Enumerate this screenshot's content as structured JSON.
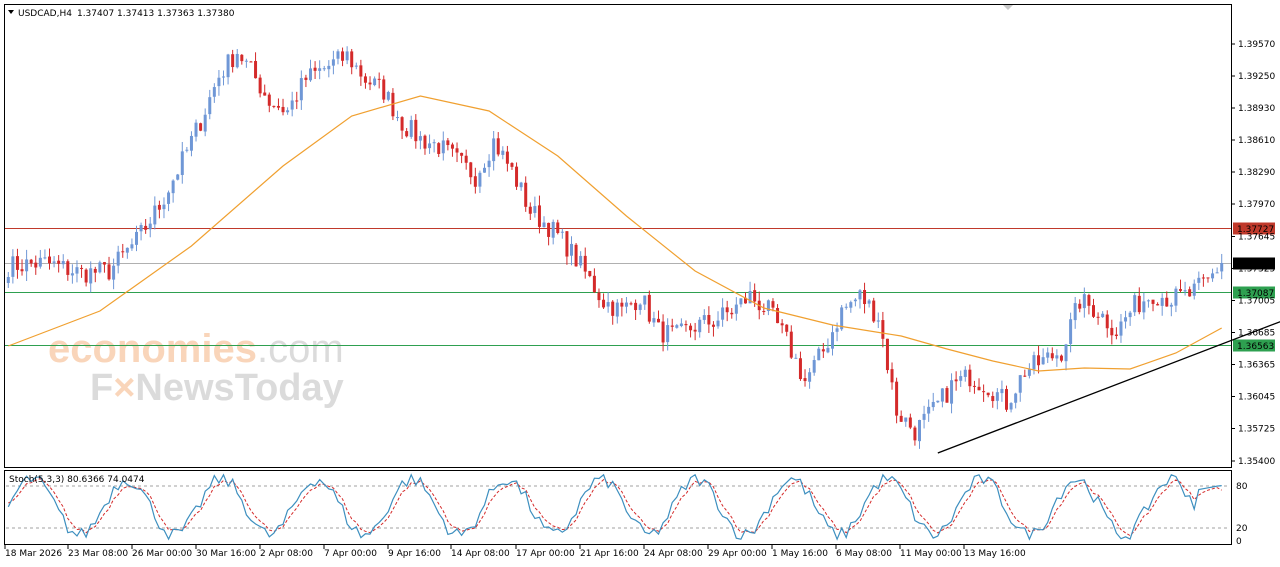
{
  "header": {
    "symbol": "USDCAD,H4",
    "ohlc": "1.37407 1.37413 1.37363 1.37380",
    "stoch_label": "Stoch(5,3,3) 80.6366 74.0474"
  },
  "watermark": {
    "brand_part1": "economies",
    "brand_part2": ".com",
    "line2_a": "F",
    "line2_b": "NewsToday"
  },
  "colors": {
    "bull": "#6f97d6",
    "bear": "#d42a2a",
    "ma": "#f0a030",
    "resistance": "#c0392b",
    "support": "#2ea050",
    "current": "#b0b0b0",
    "trendline": "#000000",
    "stoch_main": "#3d8fbf",
    "stoch_signal": "#d42a2a"
  },
  "chart_data": {
    "type": "candlestick",
    "symbol": "USDCAD",
    "timeframe": "H4",
    "ylim": [
      1.3535,
      1.3995
    ],
    "y_ticks": [
      "1.39570",
      "1.39250",
      "1.38930",
      "1.38610",
      "1.38290",
      "1.37970",
      "1.37645",
      "1.37325",
      "1.37005",
      "1.36685",
      "1.36365",
      "1.36045",
      "1.35725",
      "1.35400"
    ],
    "x_ticks": [
      "18 Mar 2026",
      "23 Mar 08:00",
      "26 Mar 00:00",
      "30 Mar 16:00",
      "2 Apr 08:00",
      "7 Apr 00:00",
      "9 Apr 16:00",
      "14 Apr 08:00",
      "17 Apr 00:00",
      "21 Apr 16:00",
      "24 Apr 08:00",
      "29 Apr 00:00",
      "1 May 16:00",
      "6 May 08:00",
      "11 May 00:00",
      "13 May 16:00"
    ],
    "price_path": [
      [
        0,
        1.3735
      ],
      [
        8,
        1.3738
      ],
      [
        16,
        1.3728
      ],
      [
        22,
        1.373
      ],
      [
        28,
        1.376
      ],
      [
        33,
        1.3795
      ],
      [
        38,
        1.384
      ],
      [
        42,
        1.388
      ],
      [
        46,
        1.3925
      ],
      [
        50,
        1.395
      ],
      [
        53,
        1.393
      ],
      [
        57,
        1.39
      ],
      [
        61,
        1.389
      ],
      [
        65,
        1.3922
      ],
      [
        70,
        1.3935
      ],
      [
        74,
        1.3945
      ],
      [
        78,
        1.3922
      ],
      [
        82,
        1.391
      ],
      [
        86,
        1.3878
      ],
      [
        90,
        1.3862
      ],
      [
        94,
        1.3855
      ],
      [
        98,
        1.384
      ],
      [
        102,
        1.3825
      ],
      [
        106,
        1.386
      ],
      [
        110,
        1.383
      ],
      [
        114,
        1.379
      ],
      [
        118,
        1.3775
      ],
      [
        122,
        1.3755
      ],
      [
        126,
        1.3728
      ],
      [
        130,
        1.37
      ],
      [
        134,
        1.369
      ],
      [
        138,
        1.3705
      ],
      [
        142,
        1.367
      ],
      [
        146,
        1.3665
      ],
      [
        150,
        1.3675
      ],
      [
        154,
        1.368
      ],
      [
        158,
        1.369
      ],
      [
        162,
        1.3705
      ],
      [
        166,
        1.369
      ],
      [
        170,
        1.366
      ],
      [
        174,
        1.362
      ],
      [
        178,
        1.365
      ],
      [
        182,
        1.369
      ],
      [
        186,
        1.3705
      ],
      [
        190,
        1.3685
      ],
      [
        194,
        1.359
      ],
      [
        198,
        1.357
      ],
      [
        202,
        1.359
      ],
      [
        206,
        1.3615
      ],
      [
        210,
        1.3625
      ],
      [
        214,
        1.3615
      ],
      [
        218,
        1.3598
      ],
      [
        222,
        1.363
      ],
      [
        226,
        1.364
      ],
      [
        230,
        1.365
      ],
      [
        234,
        1.37
      ],
      [
        238,
        1.369
      ],
      [
        242,
        1.367
      ],
      [
        246,
        1.3695
      ],
      [
        250,
        1.3708
      ],
      [
        254,
        1.3702
      ],
      [
        258,
        1.3706
      ],
      [
        262,
        1.372
      ],
      [
        265,
        1.3738
      ]
    ],
    "moving_average": [
      [
        0,
        1.3655
      ],
      [
        20,
        1.369
      ],
      [
        40,
        1.3755
      ],
      [
        60,
        1.3835
      ],
      [
        75,
        1.3885
      ],
      [
        90,
        1.3905
      ],
      [
        105,
        1.389
      ],
      [
        120,
        1.3845
      ],
      [
        135,
        1.3785
      ],
      [
        150,
        1.373
      ],
      [
        165,
        1.3693
      ],
      [
        180,
        1.3676
      ],
      [
        195,
        1.3665
      ],
      [
        205,
        1.3652
      ],
      [
        215,
        1.364
      ],
      [
        225,
        1.363
      ],
      [
        235,
        1.3633
      ],
      [
        245,
        1.3632
      ],
      [
        255,
        1.3648
      ],
      [
        265,
        1.3673
      ]
    ],
    "levels": [
      {
        "label": "1.37727",
        "value": 1.37727,
        "style": "resistance"
      },
      {
        "label": "1.37380",
        "value": 1.3738,
        "style": "current"
      },
      {
        "label": "1.37087",
        "value": 1.37087,
        "style": "support"
      },
      {
        "label": "1.36563",
        "value": 1.36563,
        "style": "support"
      }
    ],
    "trendline": [
      [
        203,
        1.3548
      ],
      [
        285,
        1.3692
      ]
    ],
    "stochastic": {
      "name": "Stoch(5,3,3)",
      "main": 80.6366,
      "signal": 74.0474,
      "ylim": [
        0,
        100
      ],
      "levels": [
        "80",
        "20"
      ],
      "zero_label": "0"
    }
  }
}
